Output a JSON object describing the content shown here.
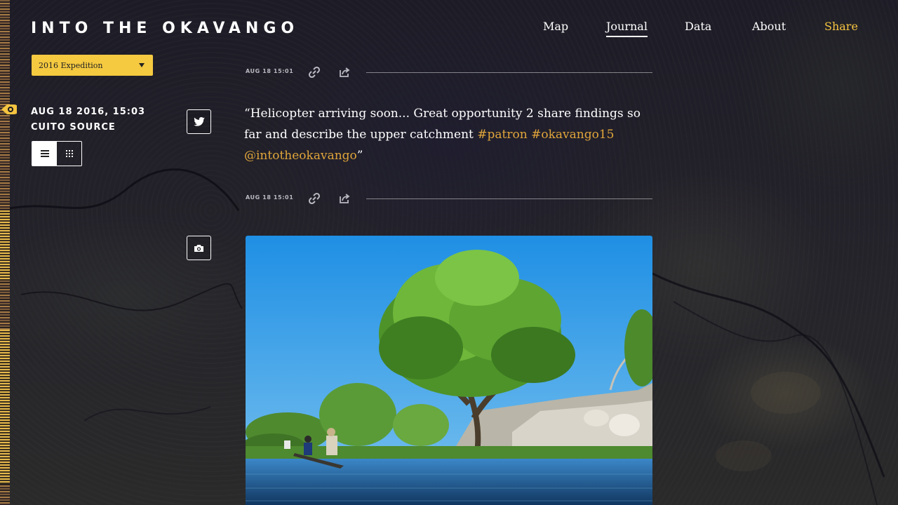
{
  "header": {
    "logo": "INTO THE OKAVANGO",
    "nav": [
      {
        "label": "Map"
      },
      {
        "label": "Journal"
      },
      {
        "label": "Data"
      },
      {
        "label": "About"
      },
      {
        "label": "Share"
      }
    ],
    "active_nav": "Journal",
    "accent_color": "#f5c440"
  },
  "sidebar": {
    "expedition_select": {
      "selected": "2016 Expedition"
    },
    "date": "AUG 18 2016, 15:03",
    "place": "CUITO SOURCE",
    "view_toggle": {
      "options": [
        "list-icon",
        "grid-icon"
      ],
      "selected": "list-icon"
    }
  },
  "posts": [
    {
      "time": "AUG 18 15:01",
      "icons": [
        "link-icon",
        "share-icon"
      ]
    },
    {
      "type": "tweet",
      "type_icon": "twitter-icon",
      "text_plain": "“Helicopter arriving soon... Great opportunity 2 share findings so far and describe the upper catchment ",
      "tag1": "#patron",
      "tag2": "#okavango15",
      "mention": "@intotheokavango",
      "text_end": "”",
      "time": "AUG 18 15:01",
      "icons": [
        "link-icon",
        "share-icon"
      ]
    },
    {
      "type": "photo",
      "type_icon": "camera-icon"
    }
  ]
}
